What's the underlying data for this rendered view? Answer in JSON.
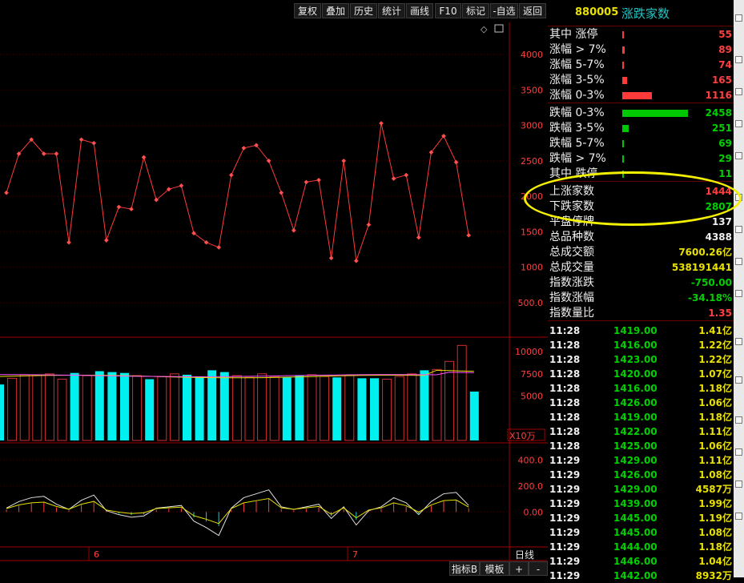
{
  "toolbar": {
    "buttons": [
      "复权",
      "叠加",
      "历史",
      "统计",
      "画线",
      "F10",
      "标记",
      "-自选",
      "返回"
    ]
  },
  "panel": {
    "code": "880005",
    "name": "涨跌家数",
    "rows": [
      {
        "label": "其中 涨停",
        "value": "55",
        "color": "red",
        "bar": 0.02
      },
      {
        "label": "涨幅 > 7%",
        "value": "89",
        "color": "red",
        "bar": 0.04
      },
      {
        "label": "涨幅 5-7%",
        "value": "74",
        "color": "red",
        "bar": 0.03
      },
      {
        "label": "涨幅 3-5%",
        "value": "165",
        "color": "red",
        "bar": 0.07
      },
      {
        "label": "涨幅 0-3%",
        "value": "1116",
        "color": "red",
        "bar": 0.45
      },
      {
        "label": "跌幅 0-3%",
        "value": "2458",
        "color": "green",
        "bar": 1.0
      },
      {
        "label": "跌幅 3-5%",
        "value": "251",
        "color": "green",
        "bar": 0.1
      },
      {
        "label": "跌幅 5-7%",
        "value": "69",
        "color": "green",
        "bar": 0.03
      },
      {
        "label": "跌幅 > 7%",
        "value": "29",
        "color": "green",
        "bar": 0.015
      },
      {
        "label": "其中 跌停",
        "value": "11",
        "color": "green",
        "bar": 0.005
      },
      {
        "label": "上涨家数",
        "value": "1444",
        "color": "red"
      },
      {
        "label": "下跌家数",
        "value": "2807",
        "color": "green"
      },
      {
        "label": "平盘停牌",
        "value": "137",
        "color": "white"
      },
      {
        "label": "总品种数",
        "value": "4388",
        "color": "white"
      },
      {
        "label": "总成交额",
        "value": "7600.26亿",
        "color": "yellow"
      },
      {
        "label": "总成交量",
        "value": "538191441",
        "color": "yellow"
      },
      {
        "label": "指数涨跌",
        "value": "-750.00",
        "color": "green"
      },
      {
        "label": "指数涨幅",
        "value": "-34.18%",
        "color": "green"
      },
      {
        "label": "指数量比",
        "value": "1.35",
        "color": "red"
      }
    ],
    "ticks": [
      {
        "time": "11:28",
        "price": "1419.00",
        "vol": "1.41亿"
      },
      {
        "time": "11:28",
        "price": "1416.00",
        "vol": "1.22亿"
      },
      {
        "time": "11:28",
        "price": "1423.00",
        "vol": "1.22亿"
      },
      {
        "time": "11:28",
        "price": "1420.00",
        "vol": "1.07亿"
      },
      {
        "time": "11:28",
        "price": "1416.00",
        "vol": "1.18亿"
      },
      {
        "time": "11:28",
        "price": "1426.00",
        "vol": "1.06亿"
      },
      {
        "time": "11:28",
        "price": "1419.00",
        "vol": "1.18亿"
      },
      {
        "time": "11:28",
        "price": "1422.00",
        "vol": "1.11亿"
      },
      {
        "time": "11:28",
        "price": "1425.00",
        "vol": "1.06亿"
      },
      {
        "time": "11:29",
        "price": "1429.00",
        "vol": "1.11亿"
      },
      {
        "time": "11:29",
        "price": "1426.00",
        "vol": "1.08亿"
      },
      {
        "time": "11:29",
        "price": "1429.00",
        "vol": "4587万"
      },
      {
        "time": "11:29",
        "price": "1439.00",
        "vol": "1.99亿"
      },
      {
        "time": "11:29",
        "price": "1445.00",
        "vol": "1.19亿"
      },
      {
        "time": "11:29",
        "price": "1445.00",
        "vol": "1.08亿"
      },
      {
        "time": "11:29",
        "price": "1444.00",
        "vol": "1.18亿"
      },
      {
        "time": "11:29",
        "price": "1446.00",
        "vol": "1.04亿"
      },
      {
        "time": "11:29",
        "price": "1442.00",
        "vol": "8932万"
      }
    ]
  },
  "chart_data": {
    "type": "line",
    "main": {
      "y_ticks": [
        4000,
        3500,
        3000,
        2500,
        2000,
        1500,
        1000,
        "500.0"
      ],
      "ylim": [
        500,
        4000
      ],
      "values": [
        2050,
        2600,
        2800,
        2600,
        2600,
        1350,
        2800,
        2750,
        1380,
        1850,
        1820,
        2550,
        1950,
        2100,
        2150,
        1480,
        1350,
        1280,
        2300,
        2680,
        2720,
        2500,
        2050,
        1520,
        2200,
        2230,
        1130,
        2500,
        1090,
        1600,
        3030,
        2250,
        2300,
        1420,
        2620,
        2850,
        2480,
        1450
      ]
    },
    "volume": {
      "y_ticks": [
        10000,
        7500,
        5000
      ],
      "unit_label": "X10万",
      "ylim": [
        0,
        11000
      ],
      "values": [
        6300,
        7000,
        7400,
        7300,
        7500,
        6900,
        7600,
        7300,
        7800,
        7700,
        7600,
        7300,
        6900,
        7200,
        7500,
        7400,
        7200,
        7900,
        7700,
        7300,
        7100,
        7500,
        7200,
        7100,
        7300,
        7400,
        7200,
        7100,
        7300,
        7000,
        7000,
        6900,
        7200,
        7500,
        7900,
        8000,
        8900,
        10700,
        5500
      ],
      "up": [
        false,
        true,
        true,
        true,
        true,
        true,
        false,
        true,
        false,
        false,
        false,
        true,
        false,
        true,
        true,
        false,
        false,
        false,
        false,
        true,
        true,
        true,
        true,
        false,
        false,
        true,
        true,
        false,
        true,
        false,
        false,
        true,
        true,
        true,
        false,
        true,
        true,
        true,
        false
      ]
    },
    "indicator": {
      "y_ticks": [
        "400.0",
        "200.0",
        "0.00"
      ],
      "ylim": [
        -250,
        500
      ],
      "values": [
        30,
        80,
        110,
        120,
        60,
        20,
        90,
        130,
        10,
        -20,
        -40,
        -30,
        30,
        40,
        50,
        -70,
        -120,
        -180,
        30,
        110,
        140,
        170,
        40,
        20,
        40,
        60,
        -50,
        40,
        -100,
        10,
        40,
        110,
        70,
        -20,
        80,
        140,
        150,
        50
      ]
    },
    "x_labels": [
      "6",
      "7"
    ]
  },
  "bottom": {
    "period": "日线",
    "buttons": [
      "指标B",
      "模板",
      "+",
      "-"
    ]
  }
}
